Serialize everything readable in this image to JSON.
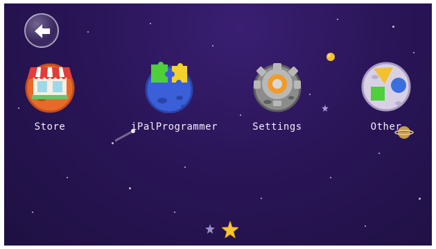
{
  "apps": [
    {
      "label": "Store",
      "icon": "store-icon"
    },
    {
      "label": "iPalProgrammer",
      "icon": "puzzle-planet-icon"
    },
    {
      "label": "Settings",
      "icon": "gear-planet-icon"
    },
    {
      "label": "Other",
      "icon": "shapes-planet-icon"
    }
  ],
  "navigation": {
    "back_icon": "back-arrow-icon"
  },
  "pager": {
    "pages": 2,
    "current_page": 2
  },
  "colors": {
    "background": "#2a1558",
    "accent_star": "#f7c928"
  }
}
